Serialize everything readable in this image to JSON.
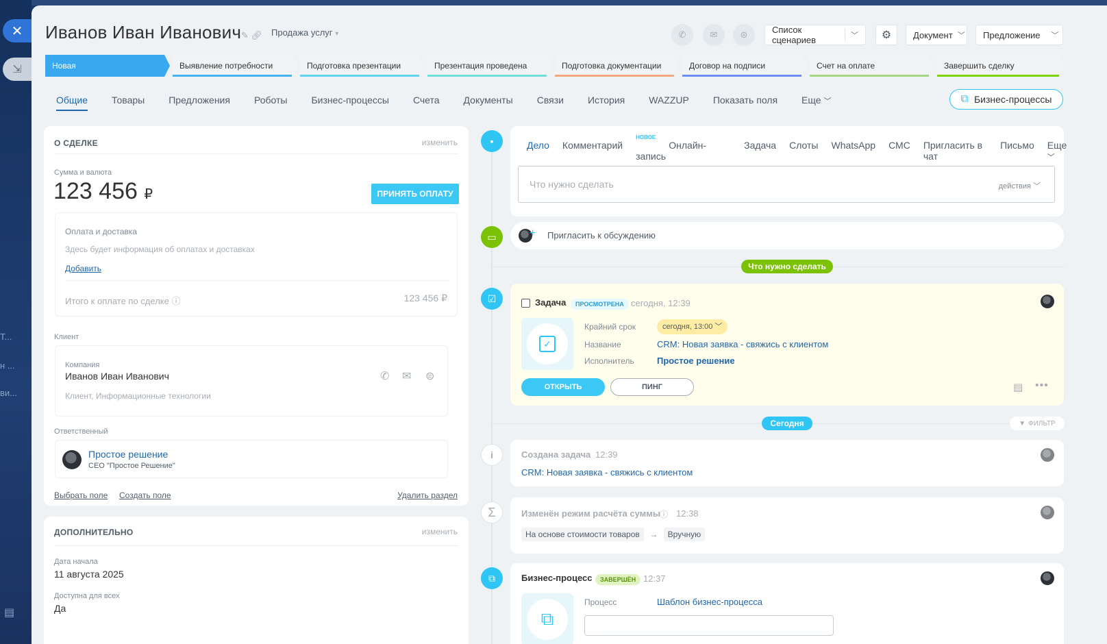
{
  "left_strip": {
    "fragments": [
      "Т...",
      "н ...",
      "ви..."
    ]
  },
  "header": {
    "title": "Иванов Иван Иванович",
    "category": "Продажа услуг",
    "scenario_btn": "Список сценариев",
    "document_btn": "Документ",
    "offer_btn": "Предложение"
  },
  "stages": [
    {
      "label": "Новая",
      "color": "#39a8ef",
      "active": true
    },
    {
      "label": "Выявление потребности",
      "color": "#47b3f1",
      "active": false
    },
    {
      "label": "Подготовка презентации",
      "color": "#5fd3ef",
      "active": false
    },
    {
      "label": "Презентация проведена",
      "color": "#6fe0d9",
      "active": false
    },
    {
      "label": "Подготовка документации",
      "color": "#f7a77f",
      "active": false
    },
    {
      "label": "Договор на подписи",
      "color": "#6c8ef5",
      "active": false
    },
    {
      "label": "Счет на оплате",
      "color": "#a3d783",
      "active": false
    },
    {
      "label": "Завершить сделку",
      "color": "#7bd500",
      "active": false
    }
  ],
  "tabs": [
    "Общие",
    "Товары",
    "Предложения",
    "Роботы",
    "Бизнес-процессы",
    "Счета",
    "Документы",
    "Связи",
    "История",
    "WAZZUP",
    "Показать поля",
    "Еще"
  ],
  "bp_button": "Бизнес-процессы",
  "about": {
    "title": "О СДЕЛКЕ",
    "edit": "изменить",
    "sum_label": "Сумма и валюта",
    "sum_value": "123 456",
    "currency": "₽",
    "pay_btn": "ПРИНЯТЬ ОПЛАТУ",
    "pay_title": "Оплата и доставка",
    "pay_info": "Здесь будет информация об оплатах и доставках",
    "pay_add": "Добавить",
    "total_label": "Итого к оплате по сделке",
    "total_value": "123 456 ₽",
    "client_label": "Клиент",
    "company_label": "Компания",
    "company_name": "Иванов Иван Иванович",
    "company_sub": "Клиент, Информационные технологии",
    "resp_label": "Ответственный",
    "resp_name": "Простое решение",
    "resp_role": "CEO \"Простое Решение\"",
    "select_field": "Выбрать поле",
    "create_field": "Создать поле",
    "delete_section": "Удалить раздел"
  },
  "extra": {
    "title": "ДОПОЛНИТЕЛЬНО",
    "edit": "изменить",
    "start_label": "Дата начала",
    "start_value": "11 августа 2025",
    "avail_label": "Доступна для всех",
    "avail_value": "Да"
  },
  "composer": {
    "tabs": [
      "Дело",
      "Комментарий",
      "Онлайн-запись",
      "Задача",
      "Слоты",
      "WhatsApp",
      "СМС",
      "Пригласить в чат",
      "Письмо",
      "Еще"
    ],
    "new_badge": "НОВОЕ",
    "placeholder": "Что нужно сделать",
    "actions": "действия"
  },
  "invite": "Пригласить к обсуждению",
  "todo_pill": "Что нужно сделать",
  "task": {
    "title": "Задача",
    "badge": "ПРОСМОТРЕНА",
    "time": "сегодня, 12:39",
    "deadline_label": "Крайний срок",
    "deadline_value": "сегодня, 13:00",
    "name_label": "Название",
    "name_value": "CRM: Новая заявка - свяжись с клиентом",
    "exec_label": "Исполнитель",
    "exec_value": "Простое решение",
    "open_btn": "ОТКРЫТЬ",
    "ping_btn": "ПИНГ"
  },
  "today_pill": "Сегодня",
  "filter": "ФИЛЬТР",
  "events": {
    "created_title": "Создана задача",
    "created_time": "12:39",
    "created_link": "CRM: Новая заявка - свяжись с клиентом",
    "sum_title": "Изменён режим расчёта суммы",
    "sum_time": "12:38",
    "sum_from": "На основе стоимости товаров",
    "sum_to": "Вручную",
    "bp_title": "Бизнес-процесс",
    "bp_badge": "ЗАВЕРШЁН",
    "bp_time": "12:37",
    "bp_label": "Процесс",
    "bp_value": "Шаблон бизнес-процесса"
  },
  "colors": {
    "accent": "#2fc6f6",
    "link": "#2067b0",
    "green": "#7bc205",
    "task_bg": "#fffdeb"
  }
}
